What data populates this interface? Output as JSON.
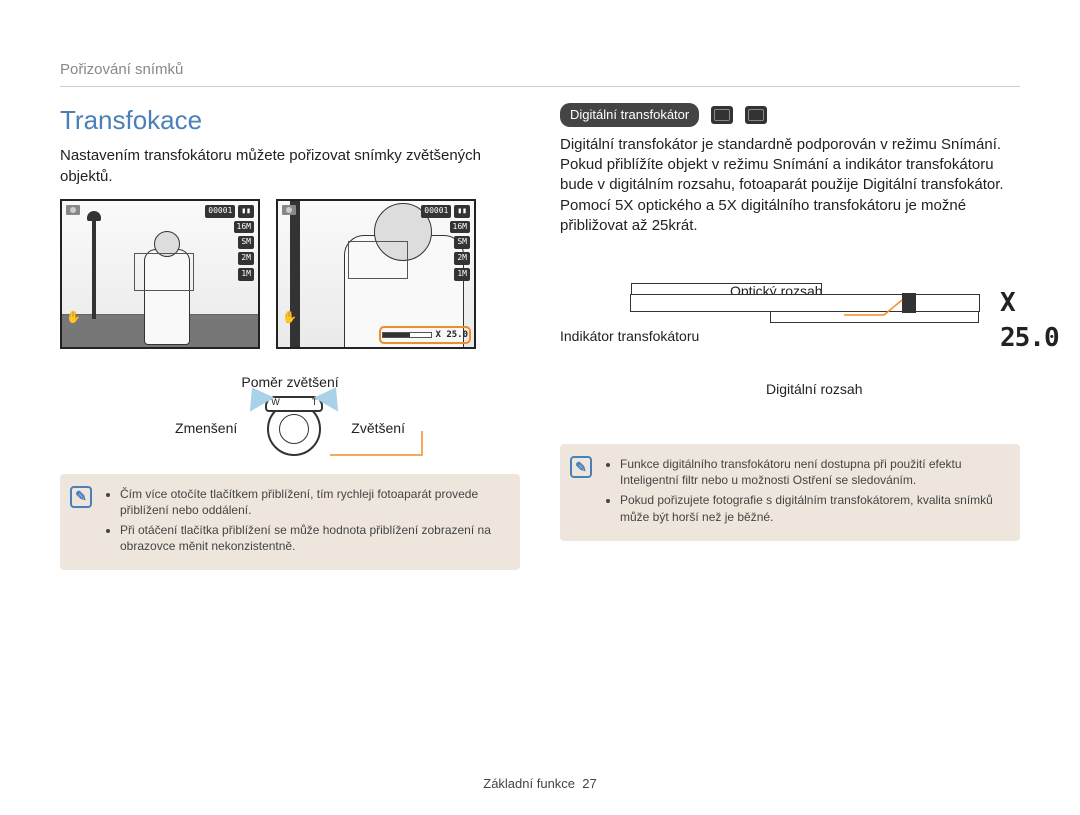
{
  "header": {
    "section": "Pořizování snímků"
  },
  "left": {
    "title": "Transfokace",
    "intro": "Nastavením transfokátoru můžete pořizovat snímky zvětšených objektů.",
    "counter": "00001",
    "battery_icon": "battery-icon",
    "zoom_value": "X 25.0",
    "osd_chips": [
      "16M",
      "SM",
      "2M",
      "1M"
    ],
    "ratio_label": "Poměr zvětšení",
    "zoom_out": "Zmenšení",
    "zoom_in": "Zvětšení",
    "wt_w": "W",
    "wt_t": "T",
    "note": {
      "items": [
        "Čím více otočíte tlačítkem přiblížení, tím rychleji fotoaparát provede přiblížení nebo oddálení.",
        "Při otáčení tlačítka přiblížení se může hodnota přiblížení zobrazení na obrazovce měnit nekonzistentně."
      ]
    }
  },
  "right": {
    "subheading": "Digitální transfokátor",
    "body": "Digitální transfokátor je standardně podporován v režimu Snímání. Pokud přiblížíte objekt v režimu Snímání a indikátor transfokátoru bude v digitálním rozsahu, fotoaparát použije Digitální transfokátor. Pomocí 5X optického a 5X digitálního transfokátoru je možné přibližovat až 25krát.",
    "optical_label": "Optický rozsah",
    "indicator_label": "Indikátor transfokátoru",
    "digital_label": "Digitální rozsah",
    "zoom_value": "X 25.0",
    "note": {
      "items": [
        "Funkce digitálního transfokátoru není dostupna při použití efektu Inteligentní filtr nebo u možnosti Ostření se sledováním.",
        "Pokud pořizujete fotografie s digitálním transfokátorem, kvalita snímků může být horší než je běžné."
      ]
    }
  },
  "footer": {
    "label": "Základní funkce",
    "page": "27"
  },
  "icons": {
    "note": "✎",
    "mode_program": "p-mode-icon",
    "mode_scene": "scn-mode-icon"
  }
}
